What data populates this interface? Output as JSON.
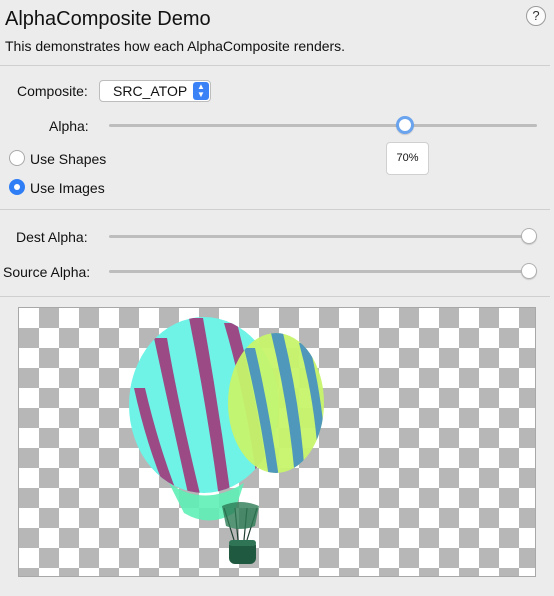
{
  "header": {
    "title": "AlphaComposite Demo",
    "description": "This demonstrates how each AlphaComposite renders.",
    "help_label": "?"
  },
  "controls": {
    "composite_label": "Composite:",
    "composite_value": "SRC_ATOP",
    "alpha_label": "Alpha:",
    "alpha_value": 0.7,
    "alpha_tooltip": "70%",
    "use_shapes_label": "Use Shapes",
    "use_shapes_selected": false,
    "use_images_label": "Use Images",
    "use_images_selected": true,
    "dest_alpha_label": "Dest Alpha:",
    "dest_alpha_value": 1.0,
    "source_alpha_label": "Source Alpha:",
    "source_alpha_value": 1.0
  },
  "preview": {
    "background": "checkerboard",
    "dest_image": "hot-air-balloon-cyan-magenta",
    "source_image": "hot-air-balloon-yellow-blue"
  },
  "colors": {
    "accent": "#2f7ef6",
    "balloon1_base": "#6ef3e6",
    "balloon1_stripe": "#9b4a86",
    "balloon2_base": "#c6f46a",
    "balloon2_stripe": "#4f98bb",
    "basket": "#1f5a40"
  }
}
